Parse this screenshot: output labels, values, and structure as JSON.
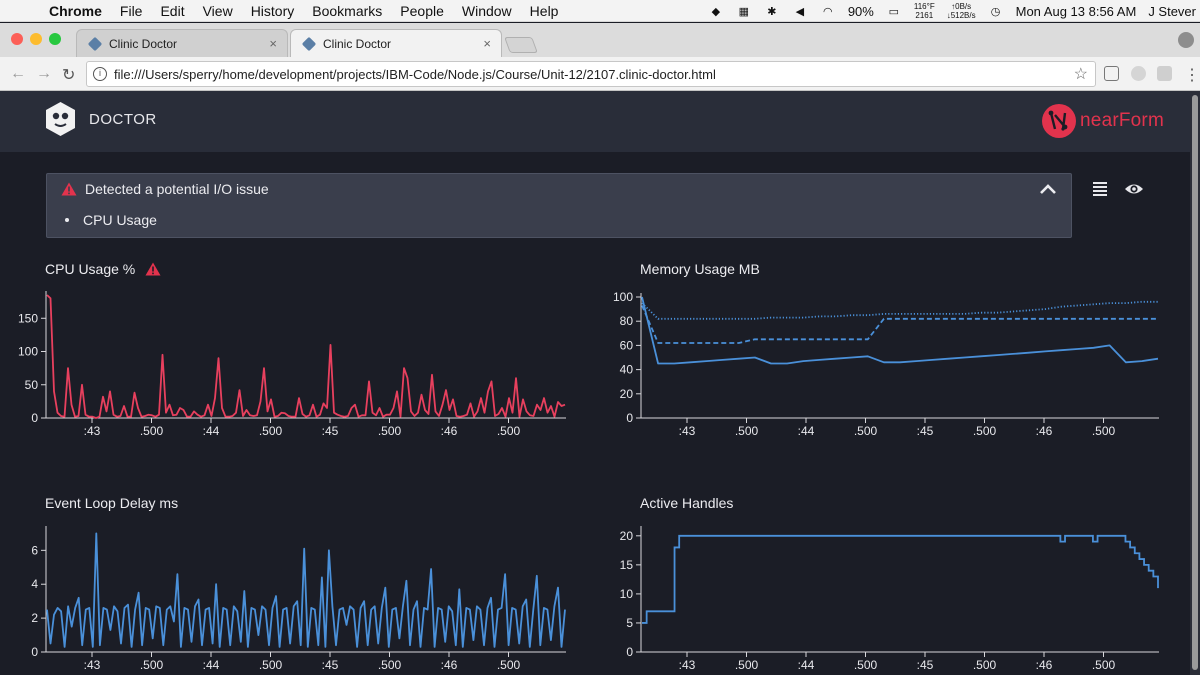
{
  "menubar": {
    "app": "Chrome",
    "items": [
      "File",
      "Edit",
      "View",
      "History",
      "Bookmarks",
      "People",
      "Window",
      "Help"
    ],
    "temp": "116°F",
    "temp_sub": "2161",
    "net_up": "↑0B/s",
    "net_down": "↓512B/s",
    "battery": "90%",
    "clock": "Mon Aug 13  8:56 AM",
    "user": "J Stever"
  },
  "browser": {
    "tabs": [
      {
        "label": "Clinic Doctor"
      },
      {
        "label": "Clinic Doctor"
      }
    ],
    "url": "file:///Users/sperry/home/development/projects/IBM-Code/Node.js/Course/Unit-12/2107.clinic-doctor.html"
  },
  "header": {
    "title": "DOCTOR",
    "brand": "nearForm"
  },
  "alert": {
    "title": "Detected a potential I/O issue",
    "items": [
      "CPU Usage"
    ]
  },
  "colors": {
    "cpu": "#e8405e",
    "blue": "#4a90d9",
    "warning": "#e2334d"
  },
  "icons": {
    "warning": "warning-triangle-icon",
    "collapse": "chevron-up-icon",
    "list": "list-icon",
    "view": "eye-icon"
  },
  "chart_data": [
    {
      "type": "line",
      "title": "CPU Usage %",
      "warning": true,
      "x_ticks": [
        ":43",
        ".500",
        ":44",
        ".500",
        ":45",
        ".500",
        ":46",
        ".500"
      ],
      "yticks": [
        0,
        50,
        100,
        150
      ],
      "ylim": [
        0,
        185
      ],
      "grid": false,
      "series": [
        {
          "values": [
            185,
            180,
            40,
            8,
            3,
            2,
            75,
            20,
            2,
            3,
            50,
            5,
            2,
            2,
            0,
            2,
            32,
            10,
            40,
            5,
            2,
            3,
            18,
            2,
            2,
            38,
            15,
            2,
            3,
            5,
            4,
            2,
            5,
            95,
            8,
            20,
            4,
            5,
            15,
            12,
            2,
            2,
            10,
            5,
            2,
            4,
            20,
            3,
            30,
            90,
            15,
            2,
            2,
            3,
            8,
            42,
            3,
            12,
            4,
            3,
            4,
            25,
            75,
            10,
            28,
            2,
            3,
            8,
            7,
            3,
            2,
            2,
            30,
            6,
            2,
            4,
            20,
            2,
            5,
            22,
            15,
            110,
            8,
            5,
            3,
            2,
            3,
            15,
            20,
            2,
            4,
            4,
            55,
            8,
            4,
            15,
            2,
            5,
            5,
            15,
            40,
            2,
            75,
            60,
            10,
            3,
            8,
            35,
            12,
            6,
            65,
            10,
            3,
            20,
            42,
            12,
            28,
            3,
            2,
            3,
            5,
            22,
            2,
            10,
            30,
            8,
            40,
            55,
            3,
            6,
            15,
            2,
            30,
            8,
            60,
            2,
            28,
            10,
            4,
            3,
            20,
            12,
            30,
            8,
            18,
            2,
            24,
            18,
            20
          ]
        }
      ]
    },
    {
      "type": "line",
      "title": "Memory Usage MB",
      "x_ticks": [
        ":43",
        ".500",
        ":44",
        ".500",
        ":45",
        ".500",
        ":46",
        ".500"
      ],
      "yticks": [
        0,
        20,
        40,
        60,
        80,
        100
      ],
      "ylim": [
        0,
        100
      ],
      "grid": false,
      "series": [
        {
          "style": "dotted",
          "values": [
            95,
            82,
            82,
            82,
            82,
            82,
            82,
            82,
            83,
            83,
            83,
            84,
            84,
            85,
            85,
            86,
            86,
            86,
            86,
            86,
            86,
            87,
            87,
            88,
            89,
            90,
            92,
            93,
            94,
            95,
            95,
            96,
            96
          ]
        },
        {
          "style": "dashed",
          "values": [
            93,
            62,
            62,
            62,
            62,
            62,
            62,
            65,
            65,
            65,
            65,
            65,
            65,
            65,
            65,
            82,
            82,
            82,
            82,
            82,
            82,
            82,
            82,
            82,
            82,
            82,
            82,
            82,
            82,
            82,
            82,
            82,
            82
          ]
        },
        {
          "style": "solid",
          "values": [
            100,
            45,
            45,
            46,
            47,
            48,
            49,
            50,
            45,
            45,
            47,
            48,
            49,
            50,
            51,
            46,
            46,
            47,
            48,
            49,
            50,
            51,
            52,
            53,
            54,
            55,
            56,
            57,
            58,
            60,
            46,
            47,
            49
          ]
        }
      ]
    },
    {
      "type": "line",
      "title": "Event Loop Delay ms",
      "x_ticks": [
        ":43",
        ".500",
        ":44",
        ".500",
        ":45",
        ".500",
        ":46",
        ".500"
      ],
      "yticks": [
        0,
        2,
        4,
        6
      ],
      "ylim": [
        0,
        7.2
      ],
      "grid": false,
      "series": [
        {
          "values": [
            2.5,
            0.5,
            2.2,
            2.6,
            2.4,
            0.3,
            2.7,
            1.5,
            2.6,
            3.2,
            0.4,
            2.5,
            2.6,
            0.3,
            7.0,
            0.4,
            2.6,
            2.5,
            1.3,
            2.7,
            2.4,
            0.5,
            2.6,
            2.8,
            0.3,
            2.5,
            3.5,
            0.4,
            2.6,
            2.5,
            0.8,
            2.7,
            2.6,
            0.4,
            2.5,
            2.7,
            1.8,
            4.6,
            0.3,
            2.6,
            2.5,
            0.6,
            2.7,
            3.1,
            0.4,
            2.5,
            2.6,
            0.5,
            4.0,
            0.3,
            2.6,
            2.5,
            0.4,
            2.7,
            2.4,
            0.6,
            3.6,
            0.3,
            2.6,
            2.5,
            1.0,
            2.7,
            2.5,
            0.4,
            2.6,
            3.3,
            0.3,
            2.5,
            2.6,
            0.5,
            2.7,
            3.0,
            0.4,
            6.1,
            0.3,
            2.6,
            2.5,
            0.4,
            4.4,
            0.3,
            6.0,
            2.7,
            0.4,
            2.5,
            2.6,
            1.6,
            2.7,
            2.5,
            0.3,
            2.6,
            3.0,
            0.4,
            2.5,
            2.7,
            0.5,
            2.6,
            3.8,
            0.3,
            2.5,
            2.6,
            0.8,
            2.7,
            4.2,
            0.4,
            2.5,
            3.0,
            0.3,
            2.6,
            2.5,
            4.9,
            0.3,
            2.6,
            2.5,
            0.6,
            2.7,
            2.4,
            0.4,
            3.7,
            0.3,
            2.6,
            2.5,
            0.7,
            2.7,
            2.5,
            0.4,
            2.6,
            3.2,
            0.3,
            2.5,
            2.6,
            4.6,
            0.4,
            2.6,
            2.5,
            0.5,
            2.7,
            3.1,
            0.3,
            2.5,
            4.5,
            0.4,
            2.6,
            2.5,
            0.7,
            2.7,
            3.8,
            0.3,
            2.5
          ]
        }
      ]
    },
    {
      "type": "line",
      "title": "Active Handles",
      "x_ticks": [
        ":43",
        ".500",
        ":44",
        ".500",
        ":45",
        ".500",
        ":46",
        ".500"
      ],
      "yticks": [
        0,
        5,
        10,
        15,
        20
      ],
      "ylim": [
        0,
        21
      ],
      "grid": false,
      "series": [
        {
          "values": [
            5,
            7,
            7,
            7,
            7,
            7,
            7,
            18,
            20,
            20,
            20,
            20,
            20,
            20,
            20,
            20,
            20,
            20,
            20,
            20,
            20,
            20,
            20,
            20,
            20,
            20,
            20,
            20,
            20,
            20,
            20,
            20,
            20,
            20,
            20,
            20,
            20,
            20,
            20,
            20,
            20,
            20,
            20,
            20,
            20,
            20,
            20,
            20,
            20,
            20,
            20,
            20,
            20,
            20,
            20,
            20,
            20,
            20,
            20,
            20,
            20,
            20,
            20,
            20,
            20,
            20,
            20,
            20,
            20,
            20,
            20,
            20,
            20,
            20,
            20,
            20,
            20,
            20,
            20,
            20,
            20,
            20,
            20,
            20,
            20,
            20,
            20,
            20,
            20,
            20,
            19,
            20,
            20,
            20,
            20,
            20,
            20,
            19,
            20,
            20,
            20,
            20,
            20,
            20,
            19,
            18,
            17,
            16,
            15,
            14,
            13,
            11
          ]
        }
      ]
    }
  ]
}
